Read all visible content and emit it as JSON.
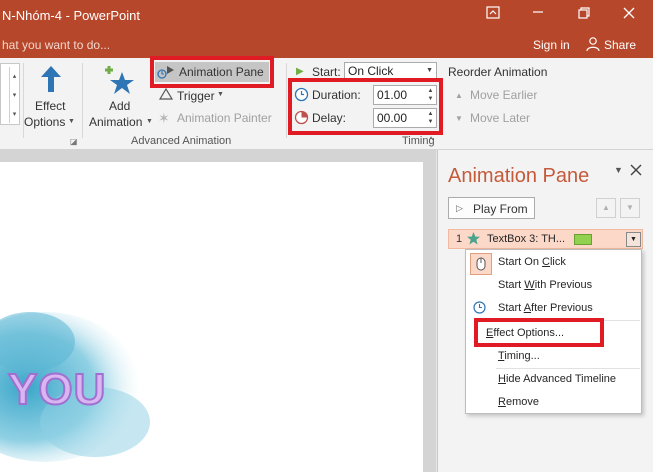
{
  "window": {
    "title": "N-Nhóm-4 - PowerPoint",
    "tell_me": "hat you want to do...",
    "sign_in": "Sign in",
    "share": "Share"
  },
  "ribbon": {
    "effect_options_line1": "Effect",
    "effect_options_line2": "Options",
    "add_animation_line1": "Add",
    "add_animation_line2": "Animation",
    "animation_pane": "Animation Pane",
    "trigger": "Trigger",
    "animation_painter": "Animation Painter",
    "group_advanced": "Advanced Animation",
    "start_label": "Start:",
    "start_value": "On Click",
    "duration_label": "Duration:",
    "duration_value": "01.00",
    "delay_label": "Delay:",
    "delay_value": "00.00",
    "group_timing": "Timing",
    "reorder": "Reorder Animation",
    "move_earlier": "Move Earlier",
    "move_later": "Move Later"
  },
  "slide": {
    "text": "YOU"
  },
  "pane": {
    "title": "Animation Pane",
    "play_from": "Play From",
    "item_number": "1",
    "item_label": "TextBox 3: TH..."
  },
  "context_menu": {
    "items": [
      {
        "label": "Start On Click",
        "ul": "C"
      },
      {
        "label": "Start With Previous",
        "ul": "W"
      },
      {
        "label": "Start After Previous",
        "ul": "A"
      },
      {
        "label": "Effect Options...",
        "ul": "E"
      },
      {
        "label": "Timing...",
        "ul": "T"
      },
      {
        "label": "Hide Advanced Timeline",
        "ul": "H"
      },
      {
        "label": "Remove",
        "ul": "R"
      }
    ]
  },
  "colors": {
    "accent": "#b7472a",
    "highlight_red": "#e01b24",
    "pane_title": "#c55a3b",
    "item_bg": "#fbd8c8"
  }
}
